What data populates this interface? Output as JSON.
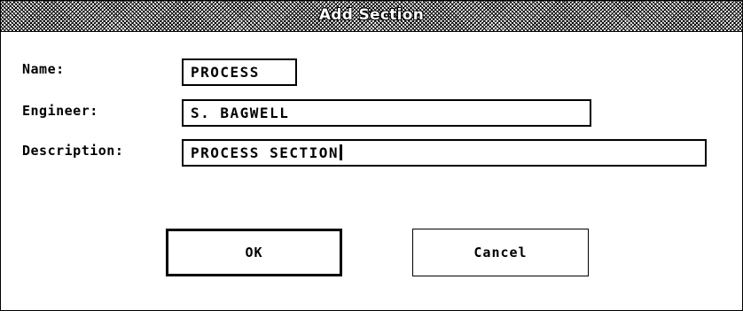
{
  "dialog": {
    "title": "Add Section"
  },
  "form": {
    "name_label": "Name:",
    "name_value": "PROCESS",
    "engineer_label": "Engineer:",
    "engineer_value": "S. BAGWELL",
    "description_label": "Description:",
    "description_value": "PROCESS SECTION"
  },
  "buttons": {
    "ok_label": "OK",
    "cancel_label": "Cancel"
  }
}
